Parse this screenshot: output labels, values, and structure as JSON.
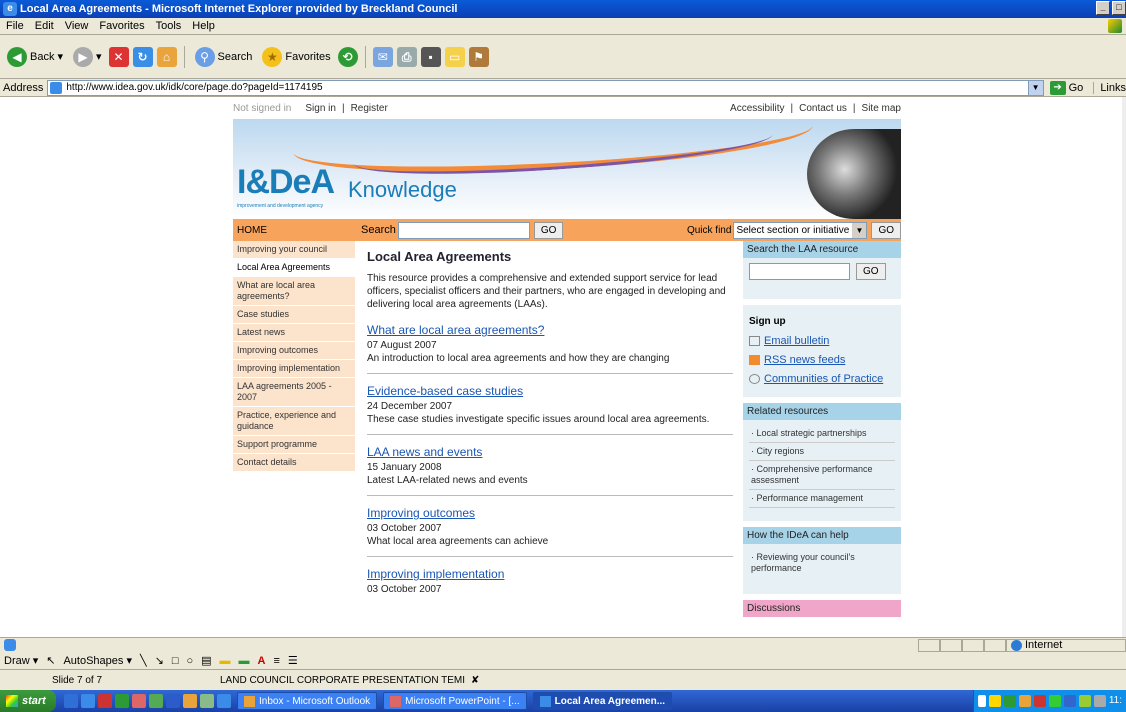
{
  "window": {
    "title": "Local Area Agreements - Microsoft Internet Explorer provided by Breckland Council"
  },
  "menu": [
    "File",
    "Edit",
    "View",
    "Favorites",
    "Tools",
    "Help"
  ],
  "toolbar": {
    "back": "Back",
    "search": "Search",
    "favorites": "Favorites"
  },
  "address": {
    "label": "Address",
    "url": "http://www.idea.gov.uk/idk/core/page.do?pageId=1174195",
    "go": "Go",
    "links": "Links"
  },
  "site": {
    "not_signed_in": "Not signed in",
    "sign_in": "Sign in",
    "register": "Register",
    "accessibility": "Accessibility",
    "contact_us": "Contact us",
    "site_map": "Site map",
    "logo": "I&DeA",
    "logo_tagline": "improvement and development agency",
    "knowledge": "Knowledge",
    "home": "HOME",
    "search_label": "Search",
    "go": "GO",
    "quick_find": "Quick find",
    "quick_find_value": "Select section or initiative"
  },
  "leftnav": [
    "Improving your council",
    "Local Area Agreements",
    "What are local area agreements?",
    "Case studies",
    "Latest news",
    "Improving outcomes",
    "Improving implementation",
    "LAA agreements 2005 - 2007",
    "Practice, experience and guidance",
    "Support programme",
    "Contact details"
  ],
  "main": {
    "title": "Local Area Agreements",
    "intro": "This resource provides a comprehensive and extended support service for lead officers, specialist officers and their partners, who are engaged in developing and delivering local area agreements (LAAs).",
    "entries": [
      {
        "link": "What are local area agreements?",
        "date": "07 August 2007",
        "desc": "An introduction to local area agreements and how they are changing"
      },
      {
        "link": "Evidence-based case studies",
        "date": "24 December 2007",
        "desc": "These case studies investigate specific issues around local area agreements."
      },
      {
        "link": "LAA news and events",
        "date": "15 January 2008",
        "desc": "Latest LAA-related news and events"
      },
      {
        "link": "Improving outcomes",
        "date": "03 October 2007",
        "desc": "What local area agreements can achieve"
      },
      {
        "link": "Improving implementation",
        "date": "03 October 2007",
        "desc": ""
      }
    ]
  },
  "right": {
    "search_head": "Search the LAA resource",
    "go": "GO",
    "signup_head": "Sign up",
    "signup_links": [
      "Email bulletin",
      "RSS news feeds",
      "Communities of Practice"
    ],
    "related_head": "Related resources",
    "related": [
      "· Local strategic partnerships",
      "· City regions",
      "· Comprehensive performance assessment",
      "· Performance management"
    ],
    "help_head": "How the IDeA can help",
    "help": [
      "· Reviewing your council's performance"
    ],
    "discussions_head": "Discussions"
  },
  "status": {
    "zone": "Internet"
  },
  "ppt": {
    "draw": "Draw ▾",
    "autoshapes": "AutoShapes ▾",
    "slide": "Slide 7 of 7",
    "template": "LAND COUNCIL CORPORATE PRESENTATION TEMI"
  },
  "taskbar": {
    "start": "start",
    "tasks": [
      "Inbox - Microsoft Outlook",
      "Microsoft PowerPoint - [...",
      "Local Area Agreemen..."
    ],
    "clock": "11:"
  }
}
